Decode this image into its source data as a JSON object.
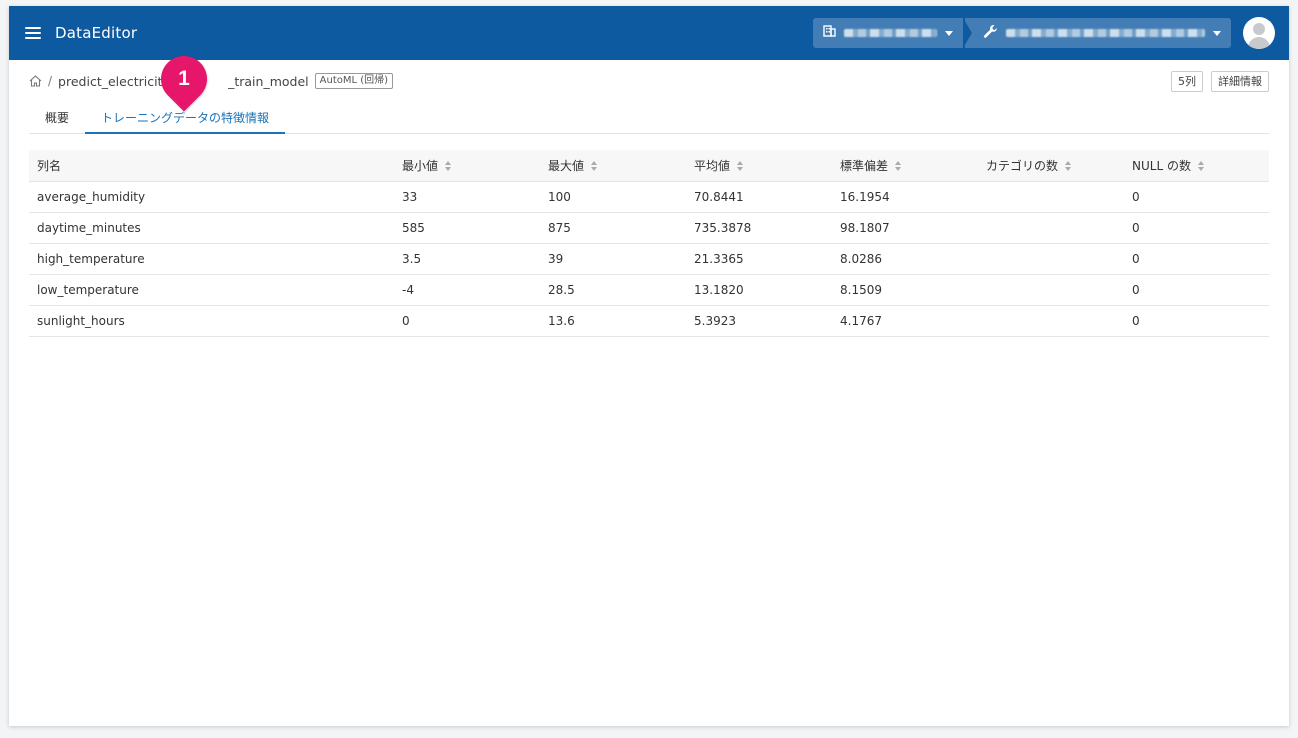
{
  "header": {
    "app_title": "DataEditor",
    "org_icon": "building-icon",
    "project_icon": "wrench-icon"
  },
  "breadcrumb": {
    "model_name_start": "predict_electricity_",
    "model_name_end": "_train_model",
    "badge": "AutoML (回帰)"
  },
  "actions": {
    "columns_button": "5列",
    "details_button": "詳細情報"
  },
  "callout": {
    "number": "1"
  },
  "tabs": [
    {
      "label": "概要"
    },
    {
      "label": "トレーニングデータの特徴情報"
    }
  ],
  "table": {
    "headers": [
      "列名",
      "最小値",
      "最大値",
      "平均値",
      "標準偏差",
      "カテゴリの数",
      "NULL の数"
    ],
    "rows": [
      [
        "average_humidity",
        "33",
        "100",
        "70.8441",
        "16.1954",
        "",
        "0"
      ],
      [
        "daytime_minutes",
        "585",
        "875",
        "735.3878",
        "98.1807",
        "",
        "0"
      ],
      [
        "high_temperature",
        "3.5",
        "39",
        "21.3365",
        "8.0286",
        "",
        "0"
      ],
      [
        "low_temperature",
        "-4",
        "28.5",
        "13.1820",
        "8.1509",
        "",
        "0"
      ],
      [
        "sunlight_hours",
        "0",
        "13.6",
        "5.3923",
        "4.1767",
        "",
        "0"
      ]
    ]
  }
}
